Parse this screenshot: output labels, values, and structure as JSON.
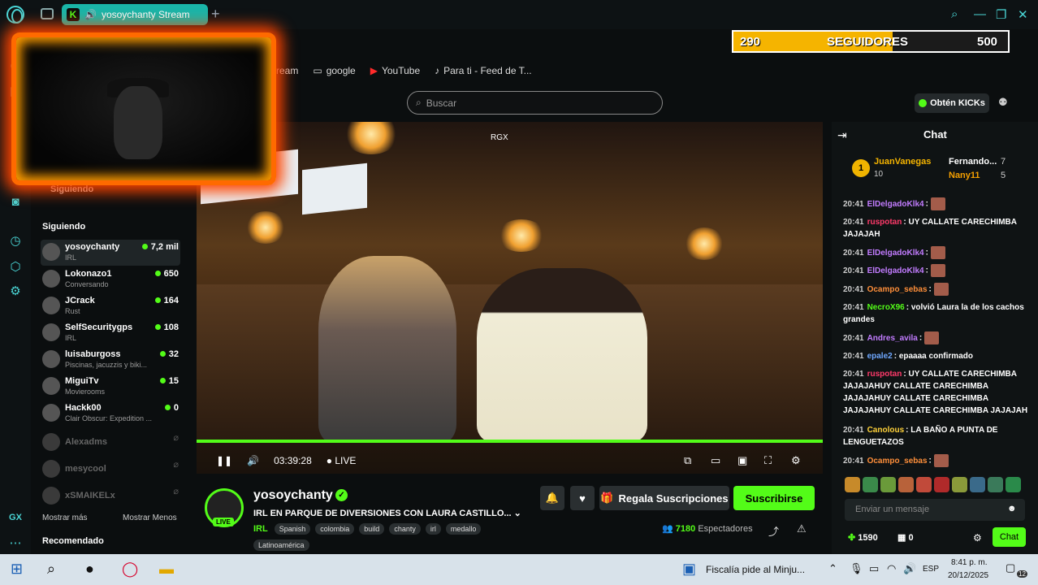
{
  "browser": {
    "tab_title": "yosoychanty Stream",
    "bookmarks": [
      {
        "label": "ream",
        "icon": "stream-icon"
      },
      {
        "label": "google",
        "icon": "folder-icon"
      },
      {
        "label": "YouTube",
        "icon": "youtube-icon"
      },
      {
        "label": "Para ti - Feed de T...",
        "icon": "tiktok-icon"
      }
    ],
    "sidebar_gx": "GX"
  },
  "goal": {
    "current": "290",
    "label": "SEGUIDORES",
    "target": "500",
    "progress": 0.58,
    "color": "#f5b400"
  },
  "header": {
    "search_placeholder": "Buscar",
    "kicks_label": "Obtén KICKs"
  },
  "sidebar": {
    "following_top": "Siguiendo",
    "following_title": "Siguiendo",
    "channels": [
      {
        "name": "yosoychanty",
        "sub": "IRL",
        "viewers": "7,2 mil",
        "online": true
      },
      {
        "name": "Lokonazo1",
        "sub": "Conversando",
        "viewers": "650",
        "online": true
      },
      {
        "name": "JCrack",
        "sub": "Rust",
        "viewers": "164",
        "online": true
      },
      {
        "name": "SelfSecuritygps",
        "sub": "IRL",
        "viewers": "108",
        "online": true
      },
      {
        "name": "luisaburgoss",
        "sub": "Piscinas, jacuzzis y biki...",
        "viewers": "32",
        "online": true
      },
      {
        "name": "MiguiTv",
        "sub": "Movierooms",
        "viewers": "15",
        "online": true
      },
      {
        "name": "Hackk00",
        "sub": "Clair Obscur: Expedition ...",
        "viewers": "0",
        "online": true
      },
      {
        "name": "Alexadms",
        "sub": "",
        "viewers": "",
        "online": false
      },
      {
        "name": "mesycool",
        "sub": "",
        "viewers": "",
        "online": false
      },
      {
        "name": "xSMAIKELx",
        "sub": "",
        "viewers": "",
        "online": false
      }
    ],
    "show_more": "Mostrar más",
    "show_less": "Mostrar Menos",
    "recommended": "Recomendado"
  },
  "player": {
    "overlay_label": "RGX",
    "time": "03:39:28",
    "live": "LIVE",
    "progress": 1.0
  },
  "stream": {
    "streamer": "yosoychanty",
    "live_badge": "LIVE",
    "title": "IRL EN PARQUE DE DIVERSIONES CON LAURA CASTILLO...",
    "category": "IRL",
    "tags": [
      "Spanish",
      "colombia",
      "build",
      "chanty",
      "irl",
      "medallo",
      "Latinoamérica"
    ],
    "gift_label": "Regala Suscripciones",
    "subscribe_label": "Suscribirse",
    "viewers_count": "7180",
    "viewers_label": "Espectadores"
  },
  "chat": {
    "title": "Chat",
    "leaders": [
      {
        "rank": "1",
        "name": "JuanVanegas",
        "count": "10"
      },
      {
        "name": "Fernando...",
        "count": "7"
      },
      {
        "name": "Nany11",
        "count": "5"
      }
    ],
    "messages": [
      {
        "time": "20:41",
        "user": "ElDelgadoKlk4",
        "color": "#c27cff",
        "text": "",
        "emote": true
      },
      {
        "time": "20:41",
        "user": "ruspotan",
        "color": "#ff3a6a",
        "text": "UY CALLATE CARECHIMBA JAJAJAH",
        "emote": false
      },
      {
        "time": "20:41",
        "user": "ElDelgadoKlk4",
        "color": "#c27cff",
        "text": "",
        "emote": true
      },
      {
        "time": "20:41",
        "user": "ElDelgadoKlk4",
        "color": "#c27cff",
        "text": "",
        "emote": true
      },
      {
        "time": "20:41",
        "user": "Ocampo_sebas",
        "color": "#ff8f3a",
        "text": "",
        "emote": true
      },
      {
        "time": "20:41",
        "user": "NecroX96",
        "color": "#53fc18",
        "text": "volvió Laura la de los cachos grandes",
        "emote": false
      },
      {
        "time": "20:41",
        "user": "Andres_avila",
        "color": "#c27cff",
        "text": "",
        "emote": true
      },
      {
        "time": "20:41",
        "user": "epale2",
        "color": "#6fa8ff",
        "text": "epaaaa confirmado",
        "emote": false
      },
      {
        "time": "20:41",
        "user": "ruspotan",
        "color": "#ff3a6a",
        "text": "UY CALLATE CARECHIMBA JAJAJAHUY CALLATE CARECHIMBA JAJAJAHUY CALLATE CARECHIMBA JAJAJAHUY CALLATE CARECHIMBA JAJAJAH",
        "emote": false
      },
      {
        "time": "20:41",
        "user": "Canolous",
        "color": "#ffd23a",
        "text": "LA BAÑO A PUNTA DE LENGUETAZOS",
        "emote": false
      },
      {
        "time": "20:41",
        "user": "Ocampo_sebas",
        "color": "#ff8f3a",
        "text": "",
        "emote": true
      }
    ],
    "input_placeholder": "Enviar un mensaje",
    "kicks_count": "1590",
    "gifts_count": "0",
    "send_label": "Chat"
  },
  "taskbar": {
    "news": "Fiscalía pide al Minju...",
    "lang": "ESP",
    "time": "8:41 p. m.",
    "date": "20/12/2025",
    "notifications": "12"
  }
}
